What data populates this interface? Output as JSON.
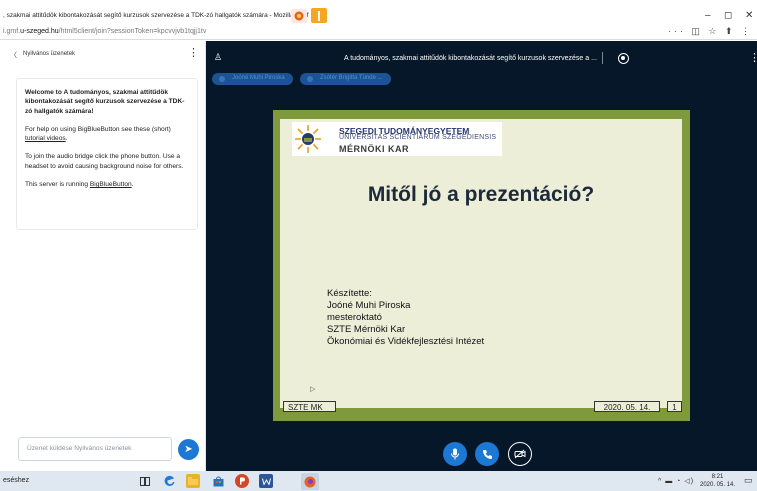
{
  "window": {
    "title": ", szakmai attitűdök kibontakozását segítő kurzusok szervezése a TDK-zó hallgatók számára - Mozilla Firef",
    "minimize": "–",
    "restore": "◻",
    "close": "✕"
  },
  "urlbar": {
    "prefix": "i.gmf.",
    "domain": "u-szeged.hu",
    "path": "/html5client/join?sessionToken=kpcvvjvb1tqjj1tv",
    "tools": "··· ◫ ☆ ⬆ ⋮"
  },
  "chat": {
    "back": "〈",
    "title": "Nyilvános üzenetek",
    "kebab": "⋮",
    "welcome_title": "Welcome to A tudományos, szakmai attitűdök kibontakozását segítő kurzusok szervezése a TDK-zó hallgatók számára!",
    "help_text": "For help on using BigBlueButton see these (short) ",
    "help_link": "tutorial videos",
    "help_end": ".",
    "audio_text": "To join the audio bridge click the phone button. Use a headset to avoid causing background noise for others.",
    "server_text": "This server is running ",
    "server_link": "BigBlueButton",
    "server_end": ".",
    "input_placeholder": "Üzenet küldése Nyilvános üzenetek",
    "send_icon": "➤"
  },
  "meeting": {
    "user_icon": "♙",
    "title": "A tudományos, szakmai attitűdök kibontakozását segítő kurzusok szervezése a ...",
    "kebab": "⋮",
    "talkers": [
      "Joóné Muhi Piroska",
      "Zsótér Brigitta Tünde ..."
    ]
  },
  "slide": {
    "logo_line1": "SZEGEDI TUDOMÁNYEGYETEM",
    "logo_line2": "UNIVERSITAS SCIENTIARUM SZEGEDIENSIS",
    "logo_line3": "MÉRNÖKI KAR",
    "title": "Mitől jó a prezentáció?",
    "info_lines": [
      "Készítette:",
      "Joóné Muhi Piroska",
      "mesteroktató",
      "SZTE Mérnöki Kar",
      "Ökonómiai és Vidékfejlesztési Intézet"
    ],
    "footer_left": "SZTE MK",
    "footer_date": "2020. 05. 14.",
    "footer_page": "1",
    "cursor": "▷"
  },
  "controls": {
    "mic_icon": "🎙",
    "phone_icon": "✆",
    "camera_icon": "⊘"
  },
  "taskbar": {
    "search_text": "eséshez",
    "tray": "^ ▬ ◔ ◁)",
    "time": "8:21",
    "date": "2020. 05. 14.",
    "notification": "▭"
  }
}
